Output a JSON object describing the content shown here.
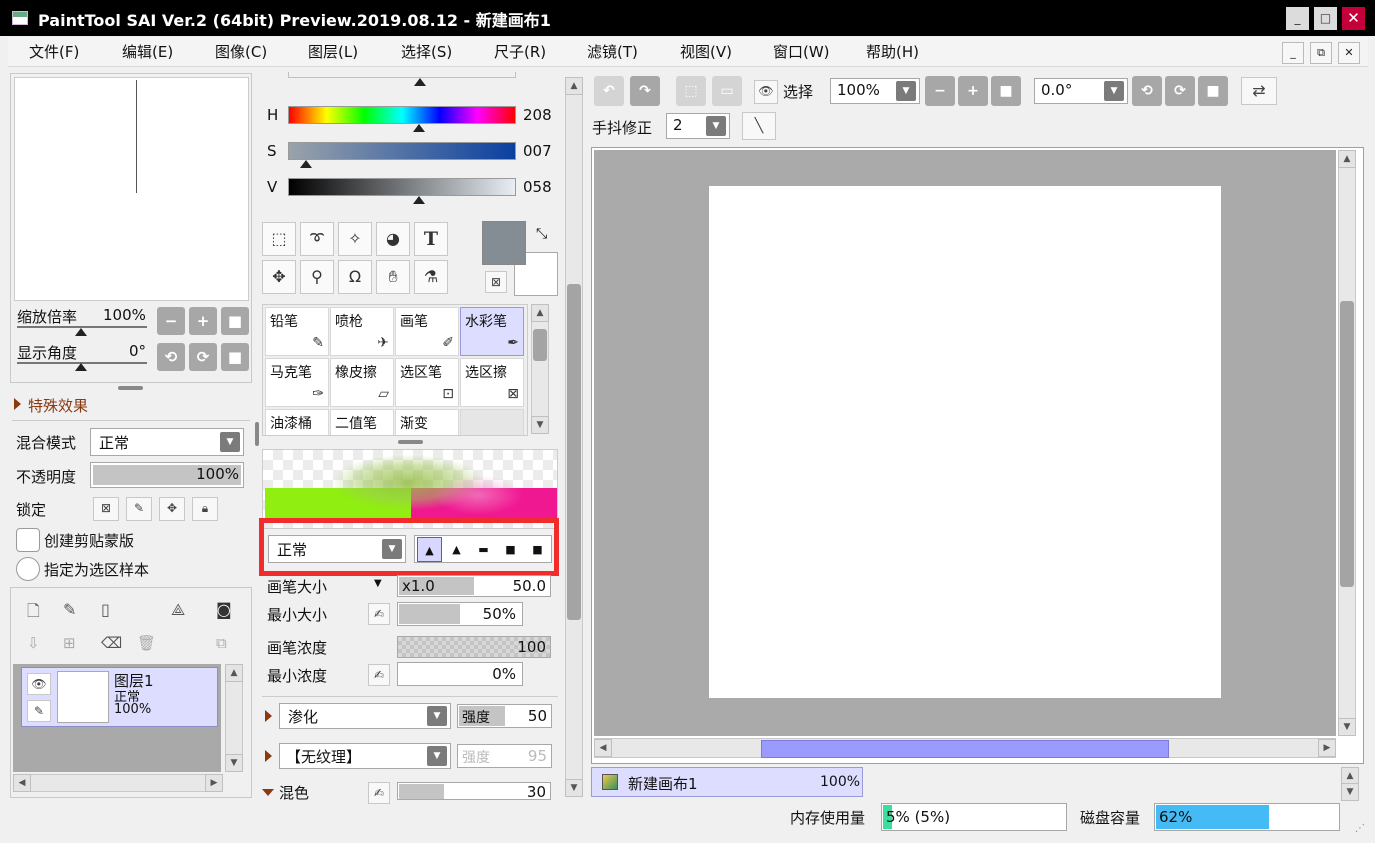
{
  "window": {
    "title": "PaintTool SAI Ver.2 (64bit) Preview.2019.08.12 - 新建画布1",
    "minimize": "_",
    "maximize": "□",
    "close": "✕"
  },
  "menu": [
    "文件(F)",
    "编辑(E)",
    "图像(C)",
    "图层(L)",
    "选择(S)",
    "尺子(R)",
    "滤镜(T)",
    "视图(V)",
    "窗口(W)",
    "帮助(H)"
  ],
  "mdi": {
    "minimize": "_",
    "restore": "⧉",
    "close": "✕"
  },
  "navigator": {
    "zoom_label": "缩放倍率",
    "zoom_value": "100%",
    "angle_label": "显示角度",
    "angle_value": "0°",
    "btn_minus": "−",
    "btn_plus": "+",
    "btn_reset": "■",
    "btn_rot_ccw": "⟲",
    "btn_rot_cw": "⟳"
  },
  "layer_props": {
    "effects_label": "特殊效果",
    "blend_label": "混合模式",
    "blend_value": "正常",
    "opacity_label": "不透明度",
    "opacity_value": "100%",
    "opacity_fraction": 1.0,
    "lock_label": "锁定",
    "clip_label": "创建剪贴蒙版",
    "sample_label": "指定为选区样本"
  },
  "layers": [
    {
      "name": "图层1",
      "mode": "正常",
      "opacity": "100%"
    }
  ],
  "color": {
    "h_label": "H",
    "h_value": "208",
    "s_label": "S",
    "s_value": "007",
    "v_label": "V",
    "v_value": "058",
    "primary": "#858d94",
    "secondary": "#ffffff"
  },
  "tools": {
    "text_tool": "T"
  },
  "brushes": [
    {
      "name": "铅笔",
      "selected": false
    },
    {
      "name": "喷枪",
      "selected": false
    },
    {
      "name": "画笔",
      "selected": false
    },
    {
      "name": "水彩笔",
      "selected": true
    },
    {
      "name": "马克笔",
      "selected": false
    },
    {
      "name": "橡皮擦",
      "selected": false
    },
    {
      "name": "选区笔",
      "selected": false
    },
    {
      "name": "选区擦",
      "selected": false
    },
    {
      "name": "油漆桶",
      "selected": false
    },
    {
      "name": "二值笔",
      "selected": false
    },
    {
      "name": "渐变",
      "selected": false
    }
  ],
  "brush_settings": {
    "blend_mode": "正常",
    "size_label": "画笔大小",
    "size_mult": "x1.0",
    "size_value": "50.0",
    "size_fraction": 0.5,
    "min_size_label": "最小大小",
    "min_size_value": "50%",
    "min_size_fraction": 0.5,
    "density_label": "画笔浓度",
    "density_value": "100",
    "min_density_label": "最小浓度",
    "min_density_value": "0%",
    "blend_effect": "渗化",
    "strength_label": "强度",
    "strength_value": "50",
    "strength_fraction": 0.5,
    "texture": "【无纹理】",
    "texture_strength_label": "强度",
    "texture_strength_value": "95",
    "mix_label": "混色",
    "mix_value": "30",
    "mix_fraction": 0.3
  },
  "toolbar": {
    "select_label": "选择",
    "zoom_value": "100%",
    "angle_value": "0.0°",
    "stabilizer_label": "手抖修正",
    "stabilizer_value": "2"
  },
  "canvas_tab": {
    "name": "新建画布1",
    "zoom": "100%"
  },
  "status": {
    "memory_label": "内存使用量",
    "memory_value": "5% (5%)",
    "memory_fraction": 0.05,
    "disk_label": "磁盘容量",
    "disk_value": "62%",
    "disk_fraction": 0.62
  }
}
